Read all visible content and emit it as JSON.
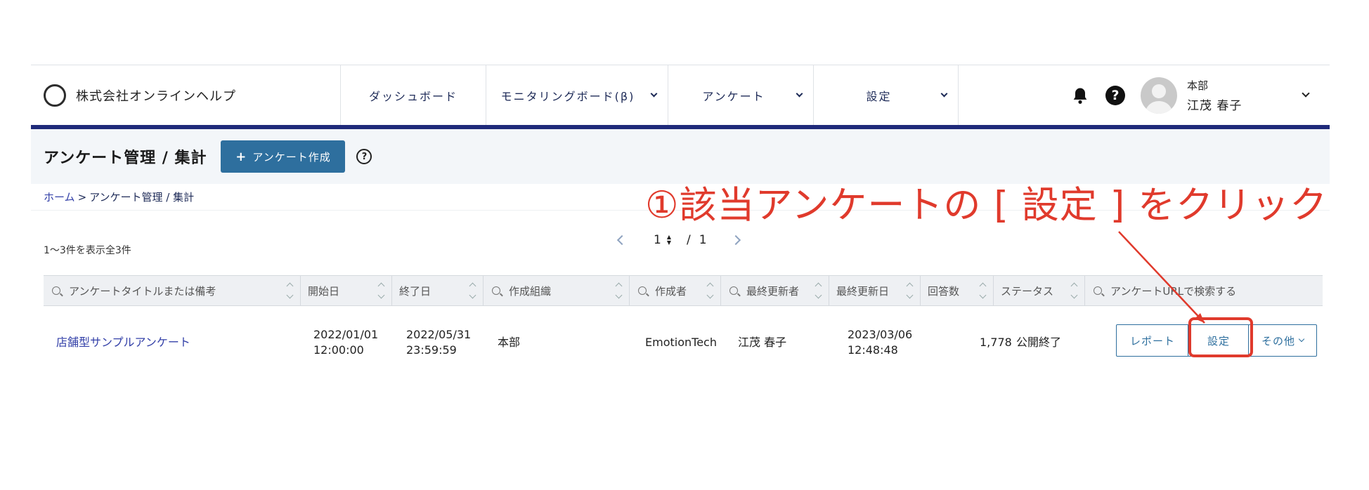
{
  "header": {
    "company_name": "株式会社オンラインヘルプ",
    "nav": [
      {
        "label": "ダッシュボード"
      },
      {
        "label": "モニタリングボード(β)"
      },
      {
        "label": "アンケート"
      },
      {
        "label": "設定"
      }
    ],
    "user": {
      "department": "本部",
      "name": "江茂 春子"
    }
  },
  "subheader": {
    "title": "アンケート管理 / 集計",
    "create_button": "アンケート作成",
    "help": "?"
  },
  "breadcrumb": {
    "home": "ホーム",
    "separator": ">",
    "current": "アンケート管理 / 集計"
  },
  "list": {
    "count_text": "1〜3件を表示全3件",
    "pagination": {
      "current": "1",
      "separator": "/",
      "total": "1"
    }
  },
  "table": {
    "columns": {
      "title_search": "アンケートタイトルまたは備考",
      "start": "開始日",
      "end": "終了日",
      "org": "作成組織",
      "creator": "作成者",
      "updater": "最終更新者",
      "updated": "最終更新日",
      "answers": "回答数",
      "status": "ステータス",
      "url_search": "アンケートURLで検索する"
    },
    "rows": [
      {
        "title": "店舗型サンプルアンケート",
        "start_date": "2022/01/01",
        "start_time": "12:00:00",
        "end_date": "2022/05/31",
        "end_time": "23:59:59",
        "org": "本部",
        "creator": "EmotionTech",
        "updater": "江茂 春子",
        "updated_date": "2023/03/06",
        "updated_time": "12:48:48",
        "answers": "1,778",
        "status": "公開終了",
        "btn_report": "レポート",
        "btn_settings": "設定",
        "btn_other": "その他"
      }
    ]
  },
  "annotation": {
    "text": "①該当アンケートの [ 設定 ] をクリック",
    "color": "#e03a2c"
  },
  "colors": {
    "accent_bar": "#1f2a7a",
    "primary_button": "#2e6f9e",
    "link": "#3340a8"
  }
}
